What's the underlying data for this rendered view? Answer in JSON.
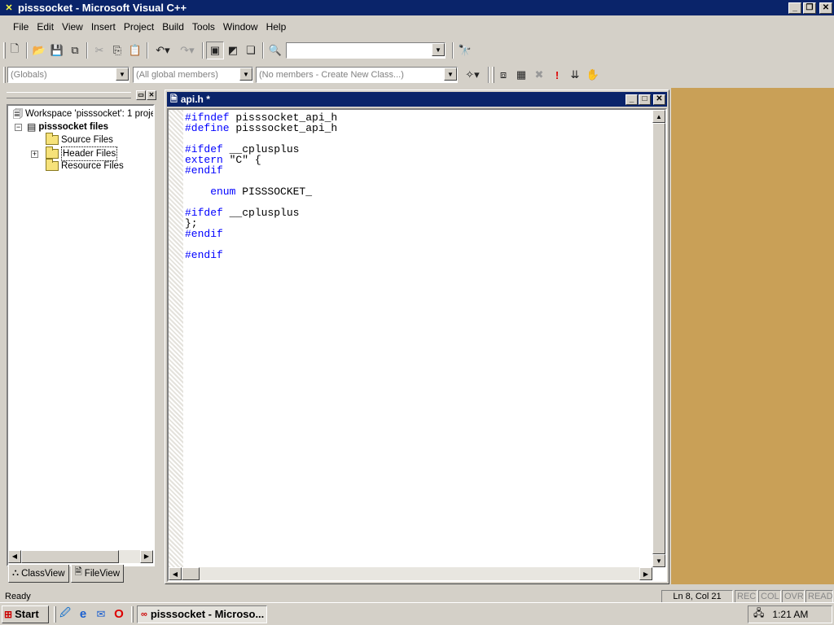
{
  "window": {
    "title": "pisssocket - Microsoft Visual C++"
  },
  "menu": [
    "File",
    "Edit",
    "View",
    "Insert",
    "Project",
    "Build",
    "Tools",
    "Window",
    "Help"
  ],
  "toolbar2": {
    "globals": "(Globals)",
    "members": "(All global members)",
    "classes": "(No members - Create New Class...)"
  },
  "workspace": {
    "root": "Workspace 'pisssocket': 1 proje",
    "project": "pisssocket files",
    "folders": [
      "Source Files",
      "Header Files",
      "Resource Files"
    ],
    "tabs": [
      "ClassView",
      "FileView"
    ]
  },
  "editor": {
    "title": "api.h *",
    "lines": [
      {
        "kw": "#ifndef",
        "rest": " pisssocket_api_h"
      },
      {
        "kw": "#define",
        "rest": " pisssocket_api_h"
      },
      {
        "kw": "",
        "rest": ""
      },
      {
        "kw": "#ifdef",
        "rest": " __cplusplus"
      },
      {
        "kw": "extern",
        "rest": " \"C\" {"
      },
      {
        "kw": "#endif",
        "rest": ""
      },
      {
        "kw": "",
        "rest": ""
      },
      {
        "kw": "    enum",
        "rest": " PISSSOCKET_"
      },
      {
        "kw": "",
        "rest": ""
      },
      {
        "kw": "#ifdef",
        "rest": " __cplusplus"
      },
      {
        "kw": "",
        "rest": "};"
      },
      {
        "kw": "#endif",
        "rest": ""
      },
      {
        "kw": "",
        "rest": ""
      },
      {
        "kw": "#endif",
        "rest": ""
      }
    ]
  },
  "status": {
    "ready": "Ready",
    "position": "Ln 8, Col 21",
    "indicators": [
      "REC",
      "COL",
      "OVR",
      "READ"
    ]
  },
  "taskbar": {
    "start": "Start",
    "task": "pisssocket - Microso...",
    "clock": "1:21 AM"
  },
  "colors": {
    "titlebar": "#0a246a",
    "desktop": "#c9a057",
    "keyword": "#0000ff"
  }
}
